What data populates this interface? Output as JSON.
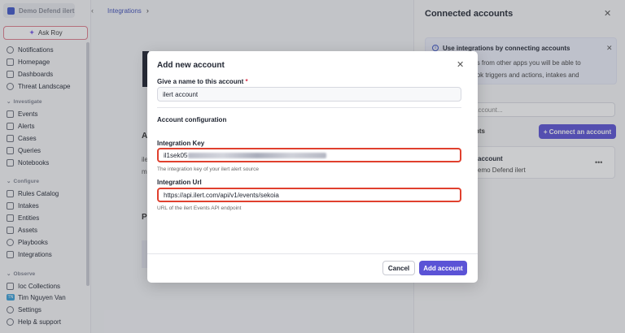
{
  "sidebar": {
    "workspace": "Demo Defend ilert",
    "ask_roy": "Ask Roy",
    "top_items": [
      "Notifications",
      "Homepage",
      "Dashboards",
      "Threat Landscape"
    ],
    "investigate_label": "Investigate",
    "investigate_items": [
      "Events",
      "Alerts",
      "Cases",
      "Queries",
      "Notebooks"
    ],
    "configure_label": "Configure",
    "configure_items": [
      "Rules Catalog",
      "Intakes",
      "Entities",
      "Assets",
      "Playbooks",
      "Integrations"
    ],
    "observe_label": "Observe",
    "observe_items": [
      "Ioc Collections"
    ],
    "user_initials": "TN",
    "user": "Tim Nguyen Van",
    "settings": "Settings",
    "help": "Help & support"
  },
  "topbar": {
    "breadcrumb": "Integrations"
  },
  "background": {
    "title_fragment": "A",
    "line1": "ile",
    "line2": "m",
    "section_fragment": "P"
  },
  "panel": {
    "title": "Connected accounts",
    "info_title": "Use integrations by connecting accounts",
    "info_line1": "g accounts from other apps you will be able to",
    "info_line2": "ire playbook triggers and actions, intakes and",
    "search_placeholder": "account...",
    "subheading": "nts",
    "connect_button": "+ Connect an account",
    "account_name": "account",
    "account_sub": "emo Defend ilert"
  },
  "modal": {
    "title": "Add new account",
    "name_label": "Give a name to this account",
    "name_required": "*",
    "name_value": "ilert account",
    "config_heading": "Account configuration",
    "key_label": "Integration Key",
    "key_value_prefix": "il1sek05",
    "key_hint": "The integration key of your ilert alert source",
    "url_label": "Integration Url",
    "url_value": "https://api.ilert.com/api/v1/events/sekoia",
    "url_hint": "URL of the ilert Events API endpoint",
    "cancel": "Cancel",
    "add": "Add account"
  }
}
